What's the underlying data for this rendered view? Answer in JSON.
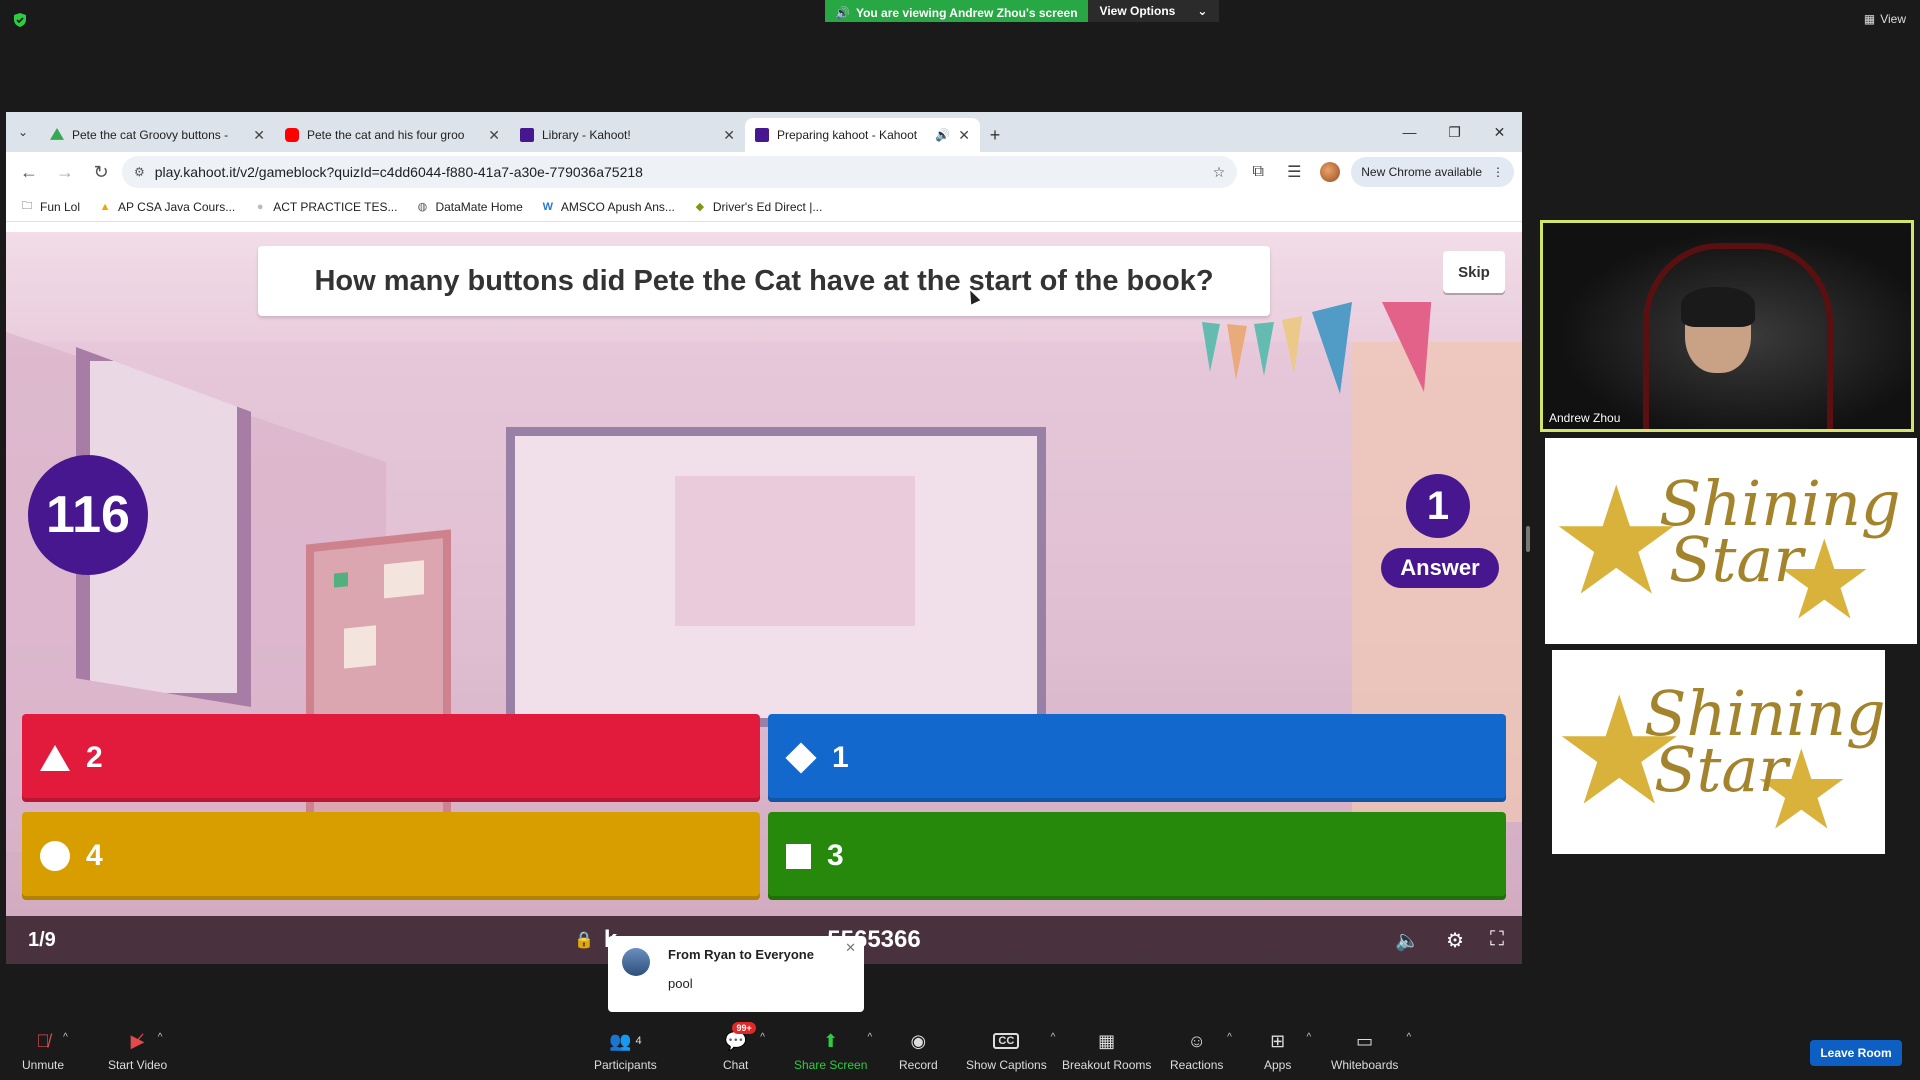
{
  "zoom": {
    "banner_viewing": "You are viewing Andrew Zhou's screen",
    "banner_options": "View Options",
    "view_label": "View",
    "participant_name": "Andrew Zhou",
    "star_card_text_line1": "Shining",
    "star_card_text_line2": "Star",
    "chat_toast": {
      "from": "From Ryan to Everyone",
      "message": "pool"
    },
    "toolbar": {
      "unmute": "Unmute",
      "start_video": "Start Video",
      "participants": "Participants",
      "participants_count": "4",
      "chat": "Chat",
      "chat_badge": "99+",
      "share_screen": "Share Screen",
      "record": "Record",
      "show_captions": "Show Captions",
      "captions_icon": "CC",
      "breakout_rooms": "Breakout Rooms",
      "reactions": "Reactions",
      "apps": "Apps",
      "whiteboards": "Whiteboards",
      "leave_room": "Leave Room"
    }
  },
  "browser": {
    "tabs": [
      {
        "title": "Pete the cat Groovy buttons - ",
        "favicon_color": "#34a853",
        "active": false
      },
      {
        "title": "Pete the cat and his four groo",
        "favicon_color": "#ff0000",
        "active": false
      },
      {
        "title": "Library - Kahoot!",
        "favicon_color": "#46178f",
        "active": false
      },
      {
        "title": "Preparing kahoot - Kahoot",
        "favicon_color": "#46178f",
        "active": true
      }
    ],
    "url": "play.kahoot.it/v2/gameblock?quizId=c4dd6044-f880-41a7-a30e-779036a75218",
    "new_chrome": "New Chrome available",
    "bookmarks": [
      {
        "label": "Fun Lol",
        "icon": "folder-icon"
      },
      {
        "label": "AP CSA Java Cours...",
        "icon": "drive-icon"
      },
      {
        "label": "ACT PRACTICE TES...",
        "icon": "globe-icon"
      },
      {
        "label": "DataMate Home",
        "icon": "globe-icon"
      },
      {
        "label": "AMSCO Apush Ans...",
        "icon": "weebly-icon"
      },
      {
        "label": "Driver's Ed Direct |...",
        "icon": "leaf-icon"
      }
    ]
  },
  "kahoot": {
    "question": "How many buttons did Pete the Cat have at the start of the book?",
    "skip": "Skip",
    "timer": "116",
    "answers_count": "1",
    "answers_label": "Answer",
    "answers": [
      {
        "shape": "triangle",
        "text": "2",
        "color": "#e21b3c"
      },
      {
        "shape": "diamond",
        "text": "1",
        "color": "#1368ce"
      },
      {
        "shape": "circle",
        "text": "4",
        "color": "#d89e00"
      },
      {
        "shape": "square",
        "text": "3",
        "color": "#26890c"
      }
    ],
    "progress": "1/9",
    "pin_visible_prefix": "k",
    "pin_visible_suffix": "5565366"
  }
}
